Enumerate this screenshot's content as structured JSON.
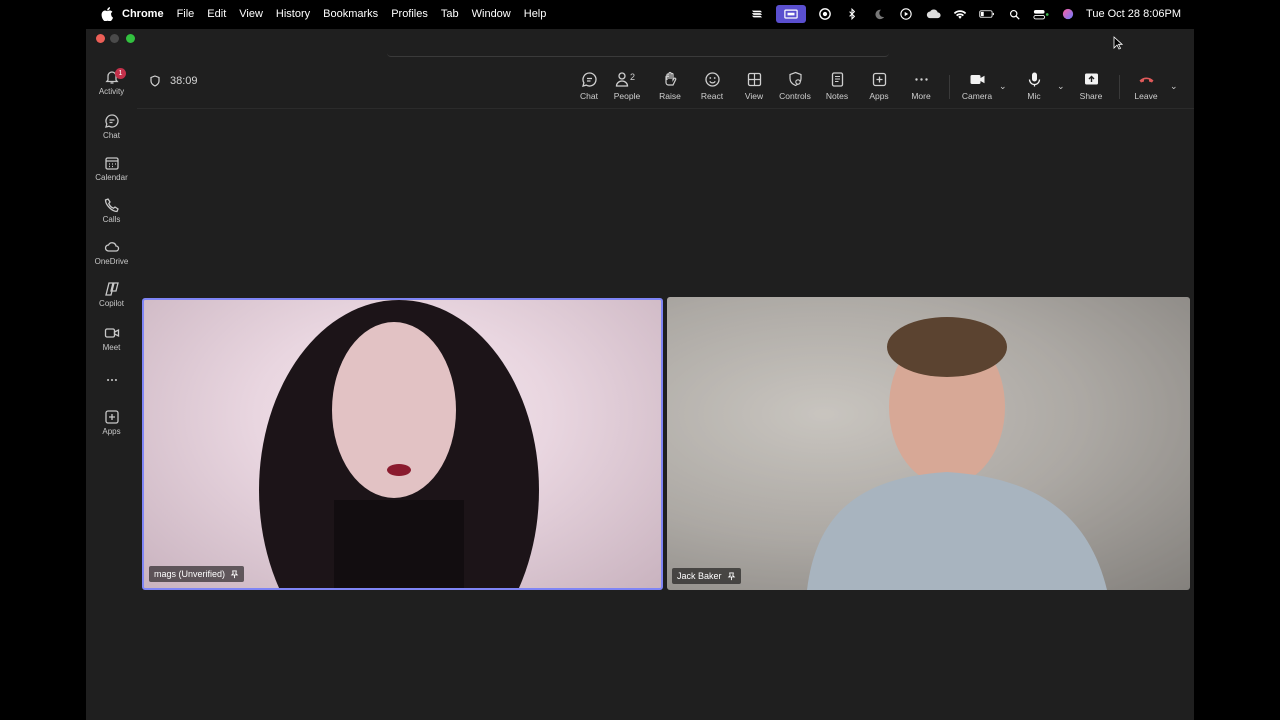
{
  "menubar": {
    "items": [
      "Chrome",
      "File",
      "Edit",
      "View",
      "History",
      "Bookmarks",
      "Profiles",
      "Tab",
      "Window",
      "Help"
    ],
    "clock": "Tue Oct 28  8:06PM"
  },
  "rail": {
    "items": [
      {
        "label": "Activity",
        "icon": "bell-icon",
        "badge": "1"
      },
      {
        "label": "Chat",
        "icon": "chat-icon"
      },
      {
        "label": "Calendar",
        "icon": "calendar-icon"
      },
      {
        "label": "Calls",
        "icon": "phone-icon"
      },
      {
        "label": "OneDrive",
        "icon": "cloud-icon"
      },
      {
        "label": "Copilot",
        "icon": "copilot-icon"
      },
      {
        "label": "Meet",
        "icon": "video-icon"
      },
      {
        "label": "Apps",
        "icon": "add-app-icon"
      }
    ]
  },
  "meeting": {
    "timer": "38:09",
    "people_count": "2",
    "toolbar": {
      "chat": "Chat",
      "people": "People",
      "raise": "Raise",
      "react": "React",
      "view": "View",
      "controls": "Controls",
      "notes": "Notes",
      "apps": "Apps",
      "more": "More",
      "camera": "Camera",
      "mic": "Mic",
      "share": "Share",
      "leave": "Leave"
    },
    "participants": [
      {
        "name": "mags (Unverified)"
      },
      {
        "name": "Jack Baker"
      }
    ]
  },
  "colors": {
    "active_border": "#7f85f5",
    "leave_red": "#e05a5a",
    "badge_red": "#c4314b"
  }
}
